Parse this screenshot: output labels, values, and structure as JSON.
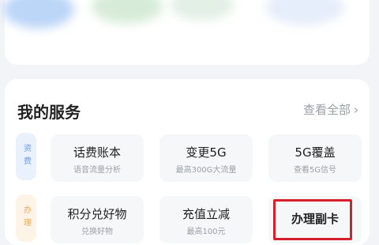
{
  "header": {},
  "services": {
    "title": "我的服务",
    "view_all": "查看全部",
    "tags": [
      "资费",
      "办理"
    ],
    "rows": [
      [
        {
          "title": "话费账本",
          "subtitle": "语音流量分析"
        },
        {
          "title": "变更5G",
          "subtitle": "最高300G大流量"
        },
        {
          "title": "5G覆盖",
          "subtitle": "查看5G信号"
        }
      ],
      [
        {
          "title": "积分兑好物",
          "subtitle": "兑换好物"
        },
        {
          "title": "充值立减",
          "subtitle": "最高100元"
        },
        {
          "title": "办理副卡",
          "subtitle": ""
        }
      ]
    ]
  },
  "colors": {
    "highlight": "#d81e2a",
    "tag_blue": "#6b9be6",
    "tag_orange": "#e8aa5a"
  }
}
